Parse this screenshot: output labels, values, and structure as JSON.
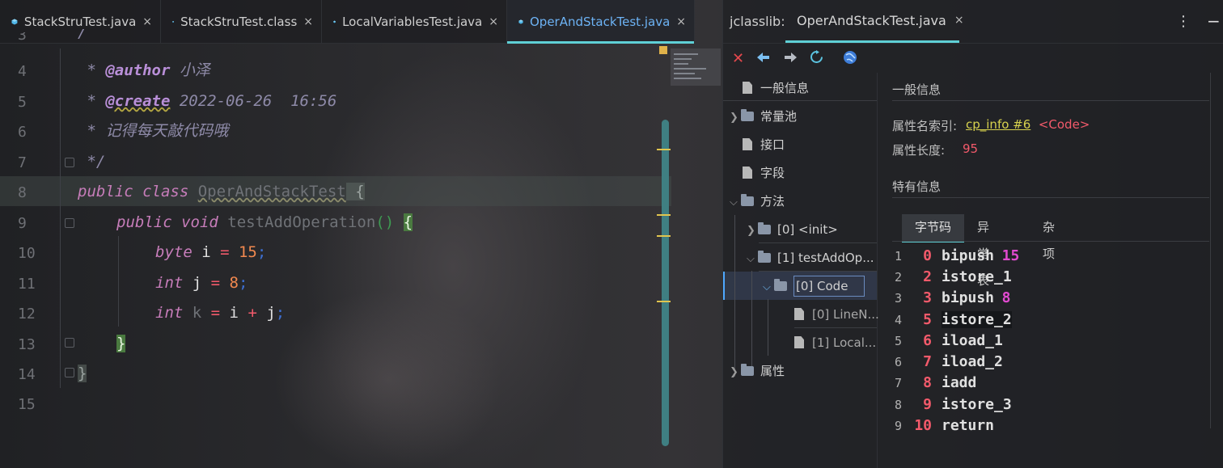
{
  "editor": {
    "tabs": [
      {
        "label": "StackStruTest.java",
        "active": false
      },
      {
        "label": "StackStruTest.class",
        "active": false
      },
      {
        "label": "LocalVariablesTest.java",
        "active": false
      },
      {
        "label": "OperAndStackTest.java",
        "active": true
      }
    ],
    "close_glyph": "×",
    "line_numbers": [
      "4",
      "5",
      "6",
      "7",
      "8",
      "9",
      "10",
      "11",
      "12",
      "13",
      "14",
      "15"
    ],
    "partial_line_top": "3",
    "code": {
      "l4_star": " * ",
      "l4_tag": "@author",
      "l4_text": " 小泽",
      "l5_star": " * ",
      "l5_tag": "@create",
      "l5_text": " 2022-06-26  16:56",
      "l6_text": " * 记得每天敲代码哦",
      "l7_text": " */",
      "l8_kw": "public class ",
      "l8_cls": "OperAndStackTest",
      "l8_brace": " {",
      "l9_kw": "public void ",
      "l9_name": "testAddOperation",
      "l9_paren": "()",
      "l9_brace": "{",
      "l10_kw": "byte ",
      "l10_var": "i",
      "l10_op": " = ",
      "l10_num": "15",
      "l11_kw": "int ",
      "l11_var": "j",
      "l11_op": " = ",
      "l11_num": "8",
      "l12_kw": "int ",
      "l12_var": "k",
      "l12_op1": " = ",
      "l12_a": "i",
      "l12_op2": " + ",
      "l12_b": "j",
      "semi": ";",
      "close_inner": "}",
      "close_outer": "}",
      "partial_top": "/"
    }
  },
  "panel": {
    "title": "jclasslib:",
    "tab_label": "OperAndStackTest.java",
    "menu_glyph": "⋮",
    "min_glyph": "−",
    "toolbar_icons": [
      "close-icon",
      "back-icon",
      "forward-icon",
      "refresh-icon",
      "web-icon"
    ],
    "toolbar_glyphs": [
      "✕",
      "🡄",
      "🡆",
      "↻",
      "🌐"
    ],
    "tree": [
      {
        "label": "一般信息",
        "type": "doc"
      },
      {
        "label": "常量池",
        "type": "folder"
      },
      {
        "label": "接口",
        "type": "doc"
      },
      {
        "label": "字段",
        "type": "doc"
      },
      {
        "label": "方法",
        "type": "folder"
      },
      {
        "label": "[0] <init>",
        "type": "folder"
      },
      {
        "label": "[1] testAddOp...",
        "type": "folder"
      },
      {
        "label": "[0] Code",
        "type": "folder"
      },
      {
        "label": "[0] LineN...",
        "type": "doc"
      },
      {
        "label": "[1] Local...",
        "type": "doc"
      },
      {
        "label": "属性",
        "type": "folder"
      }
    ],
    "general_heading": "一般信息",
    "attr_name_label": "属性名索引:",
    "attr_name_link": "cp_info #6",
    "attr_name_tag": "<Code>",
    "attr_len_label": "属性长度:",
    "attr_len_value": "95",
    "specific_heading": "特有信息",
    "subtabs": [
      "字节码",
      "异常表",
      "杂项"
    ],
    "bytecode": [
      {
        "line": "1",
        "offset": "0",
        "instr": "bipush",
        "arg": "15"
      },
      {
        "line": "2",
        "offset": "2",
        "instr": "istore_1",
        "arg": ""
      },
      {
        "line": "3",
        "offset": "3",
        "instr": "bipush",
        "arg": "8"
      },
      {
        "line": "4",
        "offset": "5",
        "instr": "istore_2",
        "arg": ""
      },
      {
        "line": "5",
        "offset": "6",
        "instr": "iload_1",
        "arg": ""
      },
      {
        "line": "6",
        "offset": "7",
        "instr": "iload_2",
        "arg": ""
      },
      {
        "line": "7",
        "offset": "8",
        "instr": "iadd",
        "arg": ""
      },
      {
        "line": "8",
        "offset": "9",
        "instr": "istore_3",
        "arg": ""
      },
      {
        "line": "9",
        "offset": "10",
        "instr": "return",
        "arg": ""
      }
    ]
  }
}
